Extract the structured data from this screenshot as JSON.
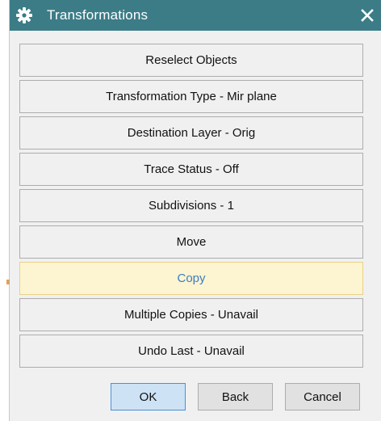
{
  "window": {
    "title": "Transformations",
    "icon": "gear-icon",
    "close_icon": "close-icon"
  },
  "menu": {
    "items": [
      {
        "label": "Reselect Objects"
      },
      {
        "label": "Transformation Type - Mir plane"
      },
      {
        "label": "Destination Layer - Orig"
      },
      {
        "label": "Trace Status - Off"
      },
      {
        "label": "Subdivisions - 1"
      },
      {
        "label": "Move"
      },
      {
        "label": "Copy"
      },
      {
        "label": "Multiple Copies - Unavail"
      },
      {
        "label": "Undo Last - Unavail"
      }
    ],
    "highlighted_item": "Copy"
  },
  "footer": {
    "ok_label": "OK",
    "back_label": "Back",
    "cancel_label": "Cancel"
  },
  "colors": {
    "titlebar": "#3b7c87",
    "highlight_bg": "#fdf4d2",
    "highlight_text": "#3a7ec0",
    "ok_border": "#4a90d2"
  }
}
